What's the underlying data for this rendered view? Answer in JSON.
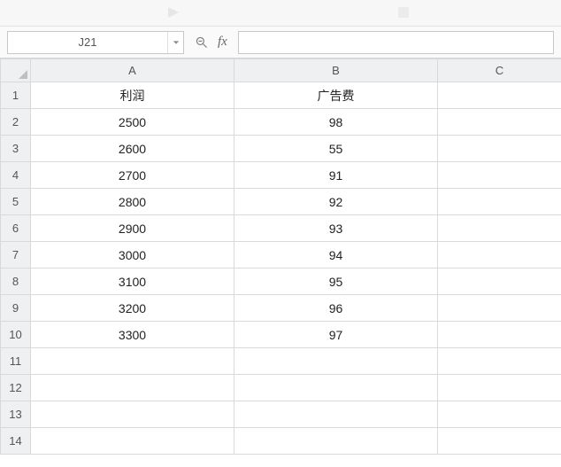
{
  "toolbar": {
    "name_box_value": "J21",
    "fx_label": "fx",
    "formula_value": ""
  },
  "columns": [
    "A",
    "B",
    "C"
  ],
  "row_numbers": [
    1,
    2,
    3,
    4,
    5,
    6,
    7,
    8,
    9,
    10,
    11,
    12,
    13,
    14
  ],
  "chart_data": {
    "type": "table",
    "headers": {
      "A": "利润",
      "B": "广告费"
    },
    "rows": [
      {
        "A": "2500",
        "B": "98"
      },
      {
        "A": "2600",
        "B": "55"
      },
      {
        "A": "2700",
        "B": "91"
      },
      {
        "A": "2800",
        "B": "92"
      },
      {
        "A": "2900",
        "B": "93"
      },
      {
        "A": "3000",
        "B": "94"
      },
      {
        "A": "3100",
        "B": "95"
      },
      {
        "A": "3200",
        "B": "96"
      },
      {
        "A": "3300",
        "B": "97"
      }
    ]
  },
  "cells": {
    "r1": {
      "A": "利润",
      "B": "广告费",
      "C": ""
    },
    "r2": {
      "A": "2500",
      "B": "98",
      "C": ""
    },
    "r3": {
      "A": "2600",
      "B": "55",
      "C": ""
    },
    "r4": {
      "A": "2700",
      "B": "91",
      "C": ""
    },
    "r5": {
      "A": "2800",
      "B": "92",
      "C": ""
    },
    "r6": {
      "A": "2900",
      "B": "93",
      "C": ""
    },
    "r7": {
      "A": "3000",
      "B": "94",
      "C": ""
    },
    "r8": {
      "A": "3100",
      "B": "95",
      "C": ""
    },
    "r9": {
      "A": "3200",
      "B": "96",
      "C": ""
    },
    "r10": {
      "A": "3300",
      "B": "97",
      "C": ""
    },
    "r11": {
      "A": "",
      "B": "",
      "C": ""
    },
    "r12": {
      "A": "",
      "B": "",
      "C": ""
    },
    "r13": {
      "A": "",
      "B": "",
      "C": ""
    },
    "r14": {
      "A": "",
      "B": "",
      "C": ""
    }
  }
}
